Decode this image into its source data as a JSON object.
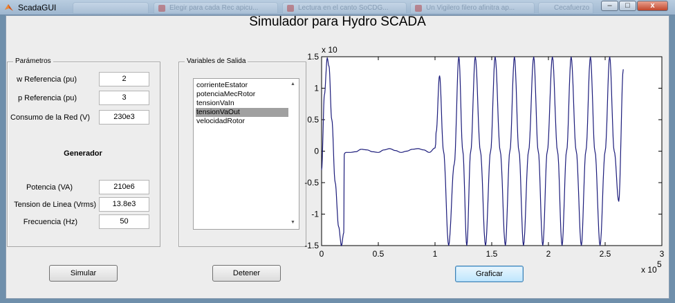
{
  "window": {
    "title": "ScadaGUI",
    "background_tabs": [
      "",
      "Elegir para cada Rec apicu...",
      "Lectura en el canto SoCDG...",
      "Un Vigilero filero afinitra ap...",
      "Cecafuerzo en..."
    ],
    "controls": {
      "minimize": "–",
      "maximize": "□",
      "close": "x"
    },
    "accent_color": "#9eb6cf"
  },
  "page_title": "Simulador para Hydro SCADA",
  "parametros": {
    "legend": "Parámetros",
    "fields": [
      {
        "label": "w Referencia (pu)",
        "value": "2"
      },
      {
        "label": "p Referencia (pu)",
        "value": "3"
      },
      {
        "label": "Consumo de la Red (V)",
        "value": "230e3"
      }
    ],
    "generador_heading": "Generador",
    "generador_fields": [
      {
        "label": "Potencia (VA)",
        "value": "210e6"
      },
      {
        "label": "Tension de Linea (Vrms)",
        "value": "13.8e3"
      },
      {
        "label": "Frecuencia (Hz)",
        "value": "50"
      }
    ]
  },
  "variables": {
    "legend": "Variables de Salida",
    "items": [
      "corrienteEstator",
      "potenciaMecRotor",
      "tensionVaIn",
      "tensionVaOut",
      "velocidadRotor"
    ],
    "selected_index": 3,
    "scroll_up": "▲",
    "scroll_down": "▼"
  },
  "buttons": {
    "simular": "Simular",
    "detener": "Detener",
    "graficar": "Graficar"
  },
  "chart_data": {
    "type": "line",
    "title": "",
    "xlabel": "",
    "ylabel": "",
    "x_exponent_label": "x 10",
    "x_exponent_power": "5",
    "y_exponent_label": "x 10",
    "xlim": [
      0,
      3
    ],
    "ylim": [
      -1.5,
      1.5
    ],
    "xticks": [
      "0",
      "0.5",
      "1",
      "1.5",
      "2",
      "2.5",
      "3"
    ],
    "yticks": [
      "1.5",
      "1",
      "0.5",
      "0",
      "-0.5",
      "-1",
      "-1.5"
    ],
    "line_color": "#1a1a7a",
    "series": [
      {
        "x": [
          0,
          0.025,
          0.05,
          0.065,
          0.09,
          0.12,
          0.15,
          0.175,
          0.195,
          0.2,
          0.205,
          0.215,
          0.25,
          0.3,
          0.35,
          0.4,
          0.45,
          0.5,
          0.55,
          0.6,
          0.65,
          0.7,
          0.75,
          0.8,
          0.85,
          0.9,
          0.95,
          1.0,
          1.005,
          1.01,
          1.04,
          1.075,
          1.12,
          1.17,
          1.21,
          1.245,
          1.28,
          1.315,
          1.355,
          1.4,
          1.445,
          1.49,
          1.53,
          1.575,
          1.62,
          1.66,
          1.7,
          1.74,
          1.78,
          1.825,
          1.87,
          1.91,
          1.95,
          1.99,
          2.035,
          2.08,
          2.12,
          2.16,
          2.2,
          2.245,
          2.29,
          2.33,
          2.37,
          2.41,
          2.455,
          2.5,
          2.54,
          2.58,
          2.62,
          2.66
        ],
        "y": [
          -0.3,
          0.9,
          1.48,
          1.35,
          0.5,
          -0.5,
          -1.2,
          -1.5,
          -1.3,
          -0.05,
          -0.03,
          -0.02,
          -0.02,
          -0.01,
          0.03,
          0.02,
          -0.01,
          -0.02,
          0.02,
          0.04,
          0.01,
          -0.02,
          0.0,
          0.03,
          0.04,
          0.02,
          -0.02,
          0.05,
          0.1,
          0.3,
          1.2,
          0.0,
          -1.5,
          -0.2,
          1.5,
          0.0,
          -1.5,
          0.0,
          1.5,
          0.0,
          -1.5,
          0.0,
          1.5,
          0.0,
          -1.5,
          0.0,
          1.5,
          0.0,
          -1.5,
          0.0,
          1.5,
          0.0,
          -1.5,
          0.0,
          1.5,
          0.0,
          -1.5,
          0.0,
          1.5,
          0.0,
          -1.5,
          0.0,
          1.5,
          0.0,
          -1.5,
          0.0,
          1.5,
          0.0,
          -0.8,
          1.3
        ]
      }
    ]
  }
}
